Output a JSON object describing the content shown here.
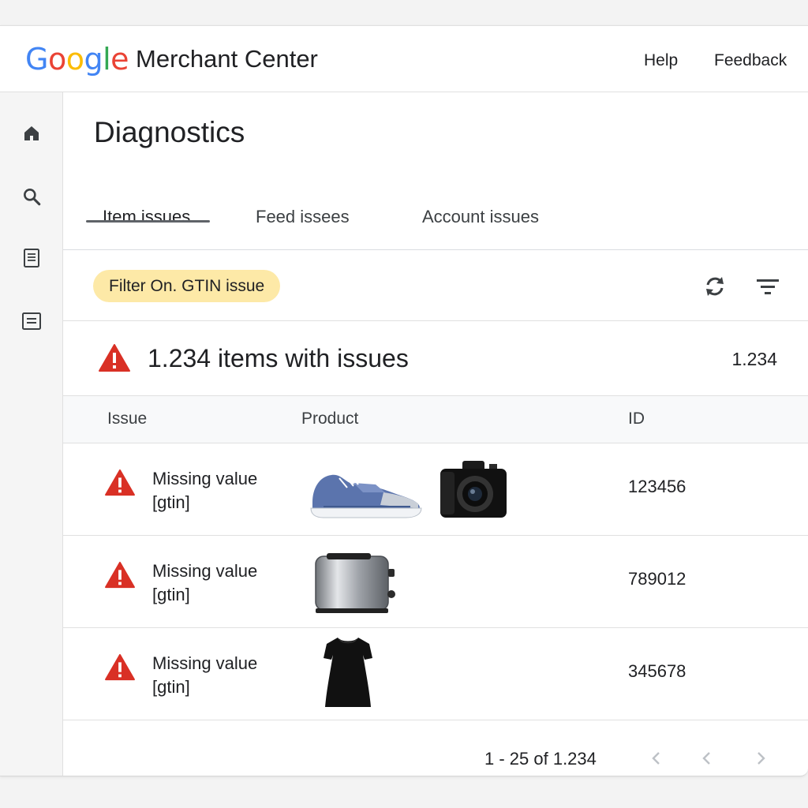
{
  "header": {
    "logo_letters": [
      "G",
      "o",
      "o",
      "g",
      "l",
      "e"
    ],
    "logo_colors": [
      "#4285F4",
      "#EA4335",
      "#FBBC05",
      "#4285F4",
      "#34A853",
      "#EA4335"
    ],
    "product_name": "Merchant Center",
    "help_label": "Help",
    "feedback_label": "Feedback"
  },
  "rail": {
    "icons": [
      "home-icon",
      "search-icon",
      "document-icon",
      "report-icon"
    ]
  },
  "page": {
    "title": "Diagnostics",
    "tabs": [
      {
        "label": "Item issues",
        "active": true
      },
      {
        "label": "Feed issees",
        "active": false
      },
      {
        "label": "Account issues",
        "active": false
      }
    ]
  },
  "filter": {
    "chip_label": "Filter On. GTIN issue",
    "chip_color": "#fde9a7",
    "tools": [
      "refresh-icon",
      "filter-list-icon"
    ]
  },
  "summary": {
    "text": "1.234 items with issues",
    "count": "1.234",
    "alert_color": "#d93025"
  },
  "table": {
    "columns": [
      "Issue",
      "Product",
      "ID"
    ],
    "rows": [
      {
        "issue_line1": "Missing value",
        "issue_line2": "[gtin]",
        "products": [
          "sneaker",
          "camera"
        ],
        "id": "123456"
      },
      {
        "issue_line1": "Missing value",
        "issue_line2": "[gtin]",
        "products": [
          "toaster"
        ],
        "id": "789012"
      },
      {
        "issue_line1": "Missing value",
        "issue_line2": "[gtin]",
        "products": [
          "dress"
        ],
        "id": "345678"
      }
    ]
  },
  "pagination": {
    "range_text": "1 - 25 of 1.234",
    "buttons": [
      "first-page-icon",
      "prev-page-icon",
      "next-page-icon"
    ]
  }
}
